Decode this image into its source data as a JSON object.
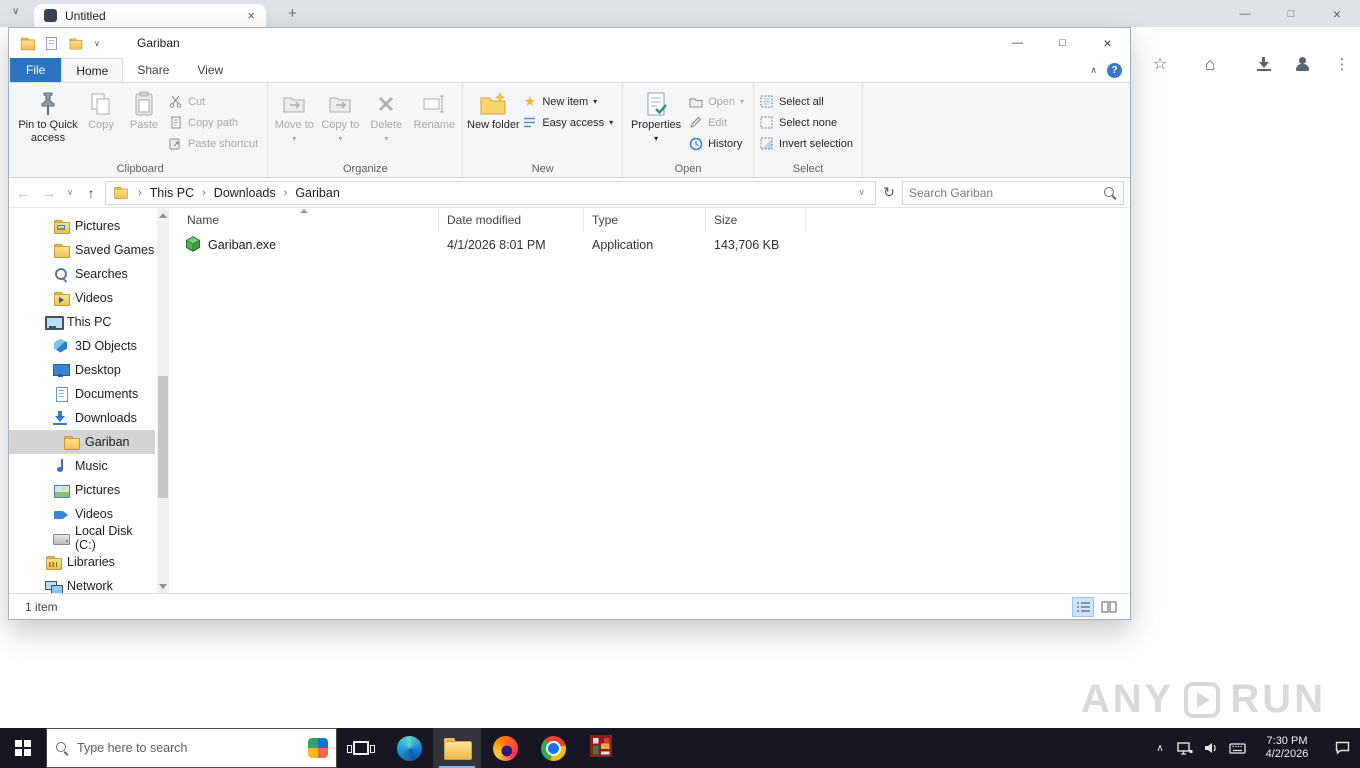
{
  "glyphs": {
    "chevron_down": "∨",
    "chevron_up": "∧",
    "chevron_right": "›",
    "back": "←",
    "forward": "→",
    "up": "↑",
    "refresh": "↻",
    "close": "×",
    "minimize": "—",
    "maximize": "□",
    "plus": "+",
    "star": "☆",
    "home": "⌂",
    "menu": "⋮",
    "help": "?",
    "dropdown": "▾"
  },
  "browser": {
    "tab_title": "Untitled"
  },
  "explorer": {
    "title": "Gariban",
    "tabs": {
      "file": "File",
      "home": "Home",
      "share": "Share",
      "view": "View"
    },
    "active_tab": "Home",
    "ribbon": {
      "clipboard": {
        "label": "Clipboard",
        "pin": "Pin to Quick access",
        "copy": "Copy",
        "paste": "Paste",
        "cut": "Cut",
        "copy_path": "Copy path",
        "paste_shortcut": "Paste shortcut"
      },
      "organize": {
        "label": "Organize",
        "move_to": "Move to",
        "copy_to": "Copy to",
        "delete": "Delete",
        "rename": "Rename"
      },
      "new_group": {
        "label": "New",
        "new_folder": "New folder",
        "new_item": "New item",
        "easy_access": "Easy access"
      },
      "open_group": {
        "label": "Open",
        "properties": "Properties",
        "open": "Open",
        "edit": "Edit",
        "history": "History"
      },
      "select_group": {
        "label": "Select",
        "select_all": "Select all",
        "select_none": "Select none",
        "invert_selection": "Invert selection"
      }
    },
    "address": {
      "crumbs": [
        "This PC",
        "Downloads",
        "Gariban"
      ],
      "search_placeholder": "Search Gariban"
    },
    "columns": {
      "name": "Name",
      "date_modified": "Date modified",
      "type": "Type",
      "size": "Size"
    },
    "files": [
      {
        "name": "Gariban.exe",
        "date_modified": "4/1/2026 8:01 PM",
        "type": "Application",
        "size": "143,706 KB",
        "icon": "green-cube-app-icon"
      }
    ],
    "sidebar": {
      "items": [
        {
          "label": "Pictures",
          "icon": "pictures-folder-icon"
        },
        {
          "label": "Saved Games",
          "icon": "folder-icon"
        },
        {
          "label": "Searches",
          "icon": "search-icon"
        },
        {
          "label": "Videos",
          "icon": "videos-folder-icon"
        },
        {
          "label": "This PC",
          "icon": "computer-icon"
        },
        {
          "label": "3D Objects",
          "icon": "3d-objects-icon"
        },
        {
          "label": "Desktop",
          "icon": "desktop-icon"
        },
        {
          "label": "Documents",
          "icon": "documents-icon"
        },
        {
          "label": "Downloads",
          "icon": "downloads-icon"
        },
        {
          "label": "Gariban",
          "icon": "folder-icon",
          "selected": true
        },
        {
          "label": "Music",
          "icon": "music-icon"
        },
        {
          "label": "Pictures",
          "icon": "pictures-icon"
        },
        {
          "label": "Videos",
          "icon": "videos-icon"
        },
        {
          "label": "Local Disk (C:)",
          "icon": "hard-drive-icon"
        },
        {
          "label": "Libraries",
          "icon": "libraries-icon"
        },
        {
          "label": "Network",
          "icon": "network-icon"
        }
      ]
    },
    "status": {
      "items_count": "1 item"
    }
  },
  "taskbar": {
    "search_placeholder": "Type here to search",
    "clock": {
      "time": "7:30 PM",
      "date": "4/2/2026"
    }
  },
  "watermark": {
    "brand_left": "ANY",
    "brand_right": "RUN"
  }
}
